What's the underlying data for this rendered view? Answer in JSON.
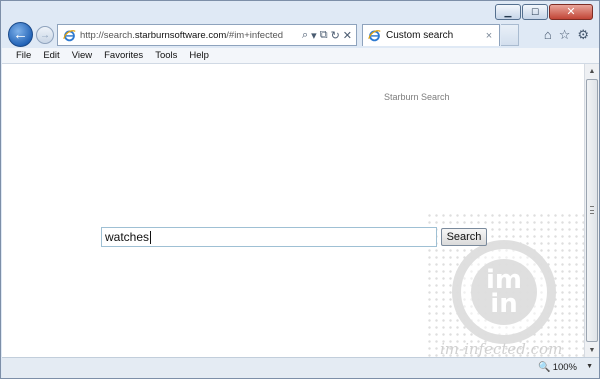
{
  "window": {
    "caption_buttons": {
      "minimize_icon": "minimize-icon",
      "maximize_icon": "maximize-icon",
      "close_icon": "close-icon"
    }
  },
  "navigation": {
    "back_icon": "back-arrow-icon",
    "forward_icon": "forward-arrow-icon",
    "address": {
      "prefix": "http://search.",
      "domain": "starburnsoftware.com",
      "suffix": "/#im+infected"
    },
    "address_tools": {
      "search": "⌕",
      "dropdown": "▾",
      "compat": "⧉",
      "refresh": "↻",
      "stop": "✕"
    },
    "tab": {
      "title": "Custom search",
      "close": "×"
    },
    "right_icons": {
      "home": "⌂",
      "favorites": "☆",
      "tools": "⚙"
    }
  },
  "menubar": {
    "items": [
      "File",
      "Edit",
      "View",
      "Favorites",
      "Tools",
      "Help"
    ]
  },
  "page": {
    "brand": "Starburn Search",
    "search_value": "watches",
    "search_button": "Search",
    "watermark": {
      "line1": "im",
      "line2": "in",
      "url": "im-infected.com"
    }
  },
  "scrollbar": {
    "up": "▲",
    "down": "▼"
  },
  "statusbar": {
    "zoom_icon": "🔍",
    "zoom_level": "100%",
    "zoom_dropdown": "▼"
  },
  "colors": {
    "chrome": "#dfe9f5",
    "back_button": "#1e5fb4",
    "close_button": "#c14536",
    "page_background": "#ffffff"
  }
}
